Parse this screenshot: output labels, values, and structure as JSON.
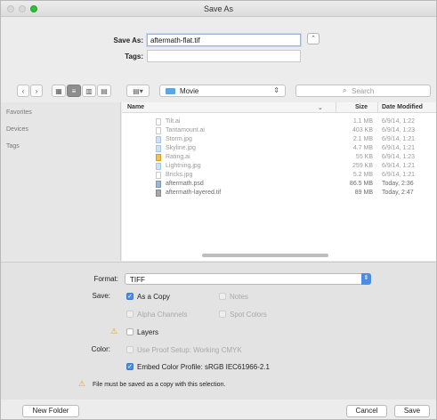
{
  "window": {
    "title": "Save As"
  },
  "save_form": {
    "save_as_label": "Save As:",
    "save_as_value": "aftermath-flat.tif",
    "tags_label": "Tags:",
    "tags_value": ""
  },
  "toolbar": {
    "location": "Movie",
    "search_placeholder": "Search"
  },
  "sidebar": {
    "sections": [
      "Favorites",
      "Devices",
      "Tags"
    ]
  },
  "filelist": {
    "columns": {
      "name": "Name",
      "size": "Size",
      "date": "Date Modified"
    },
    "rows": [
      {
        "name": "Tilt.ai",
        "size": "1.1 MB",
        "date": "6/9/14, 1:22",
        "type": "doc",
        "saveable": false
      },
      {
        "name": "Tantamount.ai",
        "size": "403 KB",
        "date": "6/9/14, 1:23",
        "type": "doc",
        "saveable": false
      },
      {
        "name": "Storm.jpg",
        "size": "2.1 MB",
        "date": "6/9/14, 1:21",
        "type": "img",
        "saveable": false
      },
      {
        "name": "Skyline.jpg",
        "size": "4.7 MB",
        "date": "6/9/14, 1:21",
        "type": "img",
        "saveable": false
      },
      {
        "name": "Rating.ai",
        "size": "55 KB",
        "date": "6/9/14, 1:23",
        "type": "ai",
        "saveable": false
      },
      {
        "name": "Lightning.jpg",
        "size": "259 KB",
        "date": "6/9/14, 1:21",
        "type": "img",
        "saveable": false
      },
      {
        "name": "Bricks.jpg",
        "size": "5.2 MB",
        "date": "6/9/14, 1:21",
        "type": "img",
        "saveable": false
      },
      {
        "name": "aftermath.psd",
        "size": "86.5 MB",
        "date": "Today, 2:36",
        "type": "psd",
        "saveable": true
      },
      {
        "name": "aftermath-layered.tif",
        "size": "89 MB",
        "date": "Today, 2:47",
        "type": "tif",
        "saveable": true
      }
    ]
  },
  "options": {
    "format_label": "Format:",
    "format_value": "TIFF",
    "save_label": "Save:",
    "as_a_copy": "As a Copy",
    "notes": "Notes",
    "alpha_channels": "Alpha Channels",
    "spot_colors": "Spot Colors",
    "layers": "Layers",
    "color_label": "Color:",
    "use_proof_setup": "Use Proof Setup:  Working CMYK",
    "embed_color_profile": "Embed Color Profile:  sRGB IEC61966-2.1",
    "warning": "File must be saved as a copy with this selection."
  },
  "buttons": {
    "new_folder": "New Folder",
    "cancel": "Cancel",
    "save": "Save"
  },
  "colors": {
    "accent": "#4a8de6",
    "warning": "#e4a515",
    "zoom": "#2fbf3c"
  }
}
